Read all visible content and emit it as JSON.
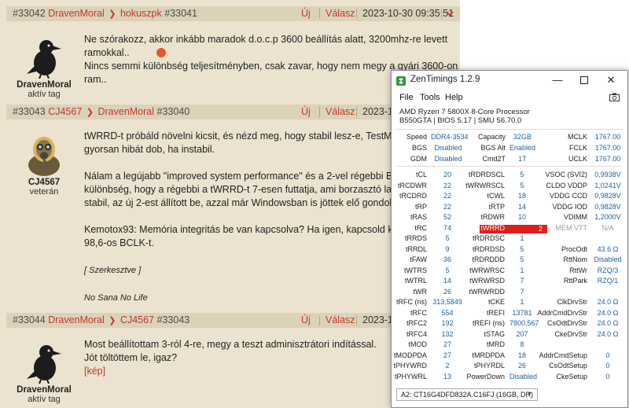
{
  "forum": {
    "posts": [
      {
        "id": "#33042",
        "author": "DravenMoral",
        "reply_to": "hokuszpk",
        "reply_id": "#33041",
        "action_new": "Új",
        "action_reply": "Válasz",
        "date": "2023-10-30 09:35:51",
        "rank": "aktív tag",
        "lines": [
          "Ne szórakozz, akkor inkább maradok d.o.c.p 3600 beállítás alatt, 3200mhz-re levett",
          "ramokkal..",
          "Nincs semmi különbség teljesítményben, csak zavar, hogy nem megy a gyári 3600-on a",
          "ram.."
        ]
      },
      {
        "id": "#33043",
        "author": "CJ4567",
        "reply_to": "DravenMoral",
        "reply_id": "#33040",
        "action_new": "Új",
        "action_reply": "Válasz",
        "date": "2023-10-",
        "rank": "veterán",
        "lines": [
          "tWRRD-t próbáld növelni kicsit, és nézd meg, hogy stabil lesz-e, TestMem5 1",
          "gyorsan hibát dob, ha instabil.",
          "Nálam a legújabb \"improved system performance\" és a 2-vel régebbi BIOS k",
          "különbség, hogy a régebbi a tWRRD-t 7-esen futtatja, ami borzasztó laza, de",
          "stabil, az új 2-est állított be, azzal már Windowsban is jöttek elő gondok.",
          "Kemotox93: Memória integritás be van kapcsolva? Ha igen, kapcsold ki, az",
          "98,6-os BCLK-t."
        ],
        "edited": "[ Szerkesztve ]",
        "signature": "No Sana No Life"
      },
      {
        "id": "#33044",
        "author": "DravenMoral",
        "reply_to": "CJ4567",
        "reply_id": "#33043",
        "action_new": "Új",
        "action_reply": "Válasz",
        "date": "2023-10-",
        "rank": "aktív tag",
        "lines": [
          "Most beállítottam 3-ról 4-re, megy a teszt adminisztrátori indítással.",
          "Jót töltöttem le, igaz?"
        ],
        "link": "[kép]"
      }
    ]
  },
  "zentimings": {
    "title": "ZenTimings 1.2.9",
    "menu": [
      "File",
      "Tools",
      "Help"
    ],
    "cpu_line1": "AMD Ryzen 7 5800X 8-Core Processor",
    "cpu_line2": "B550GTA | BIOS 5.17 | SMU 56.70.0",
    "top": [
      [
        "Speed",
        "DDR4-3534",
        "Capacity",
        "32GB",
        "MCLK",
        "1767.00"
      ],
      [
        "BGS",
        "Disabled",
        "BGS Alt",
        "Enabled",
        "FCLK",
        "1767.00"
      ],
      [
        "GDM",
        "Disabled",
        "Cmd2T",
        "1T",
        "UCLK",
        "1767.00"
      ]
    ],
    "timings": [
      [
        "tCL",
        "20",
        "tRDRDSCL",
        "5",
        "VSOC (SVI2)",
        "0,9938V"
      ],
      [
        "tRCDWR",
        "22",
        "tWRWRSCL",
        "5",
        "CLDO VDDP",
        "1,0241V"
      ],
      [
        "tRCDRD",
        "22",
        "tCWL",
        "18",
        "VDDG CCD",
        "0,9828V"
      ],
      [
        "tRP",
        "22",
        "tRTP",
        "14",
        "VDDG IOD",
        "0,9828V"
      ],
      [
        "tRAS",
        "52",
        "tRDWR",
        "10",
        "VDIMM",
        "1,2000V"
      ],
      [
        "tRC",
        "74",
        "tWRRD",
        "2",
        "MEM VTT",
        "N/A"
      ],
      [
        "tRRDS",
        "5",
        "tRDRDSC",
        "1",
        "",
        ""
      ],
      [
        "tRRDL",
        "9",
        "tRDRDSD",
        "5",
        "ProcOdt",
        "43.6 Ω"
      ],
      [
        "tFAW",
        "36",
        "tRDRDDD",
        "5",
        "RttNom",
        "Disabled"
      ],
      [
        "tWTRS",
        "5",
        "tWRWRSC",
        "1",
        "RttWr",
        "RZQ/3"
      ],
      [
        "tWTRL",
        "14",
        "tWRWRSD",
        "7",
        "RttPark",
        "RZQ/1"
      ],
      [
        "tWR",
        "26",
        "tWRWRDD",
        "7",
        "",
        ""
      ],
      [
        "tRFC (ns)",
        "313,5849",
        "tCKE",
        "1",
        "ClkDrvStr",
        "24.0 Ω"
      ],
      [
        "tRFC",
        "554",
        "tREFI",
        "13781",
        "AddrCmdDrvStr",
        "24.0 Ω"
      ],
      [
        "tRFC2",
        "192",
        "tREFI (ns)",
        "7800,567",
        "CsOdtDrvStr",
        "24.0 Ω"
      ],
      [
        "tRFC4",
        "132",
        "tSTAG",
        "207",
        "CkeDrvStr",
        "24.0 Ω"
      ],
      [
        "tMOD",
        "27",
        "tMRD",
        "8",
        "",
        ""
      ],
      [
        "tMODPDA",
        "27",
        "tMRDPDA",
        "18",
        "AddrCmdSetup",
        "0"
      ],
      [
        "tPHYWRD",
        "2",
        "tPHYRDL",
        "26",
        "CsOdtSetup",
        "0"
      ],
      [
        "tPHYWRL",
        "13",
        "PowerDown",
        "Disabled",
        "CkeSetup",
        "0"
      ]
    ],
    "dimm": "A2: CT16G4DFD832A.C16FJ (16GB, DR)",
    "highlight_color": "#e21b1b",
    "value_color": "#1f5f9f"
  }
}
